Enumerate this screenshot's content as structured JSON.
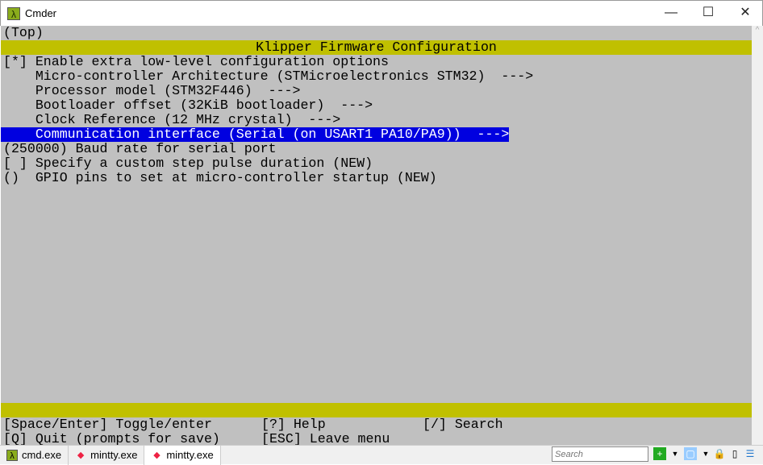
{
  "window": {
    "title": "Cmder",
    "minimize": "—",
    "maximize": "☐",
    "close": "✕"
  },
  "terminal": {
    "breadcrumb": "(Top)",
    "header": "Klipper Firmware Configuration",
    "items": [
      "[*] Enable extra low-level configuration options",
      "    Micro-controller Architecture (STMicroelectronics STM32)  --->",
      "    Processor model (STM32F446)  --->",
      "    Bootloader offset (32KiB bootloader)  --->",
      "    Clock Reference (12 MHz crystal)  --->",
      "    Communication interface (Serial (on USART1 PA10/PA9))  --->",
      "(250000) Baud rate for serial port",
      "[ ] Specify a custom step pulse duration (NEW)",
      "()  GPIO pins to set at micro-controller startup (NEW)"
    ],
    "selected_index": 5,
    "help": [
      [
        "[Space/Enter] Toggle/enter",
        "[?] Help",
        "[/] Search"
      ],
      [
        "[Q] Quit (prompts for save)",
        "[ESC] Leave menu",
        ""
      ]
    ],
    "colors": {
      "background": "#c0c0c0",
      "header": "#c0c000",
      "selection": "#0000e0"
    }
  },
  "tabs": [
    {
      "label": "cmd.exe",
      "icon": "lambda-icon"
    },
    {
      "label": "mintty.exe",
      "icon": "git-icon"
    },
    {
      "label": "mintty.exe",
      "icon": "git-icon",
      "active": true
    }
  ],
  "toolbar": {
    "search_placeholder": "Search"
  }
}
